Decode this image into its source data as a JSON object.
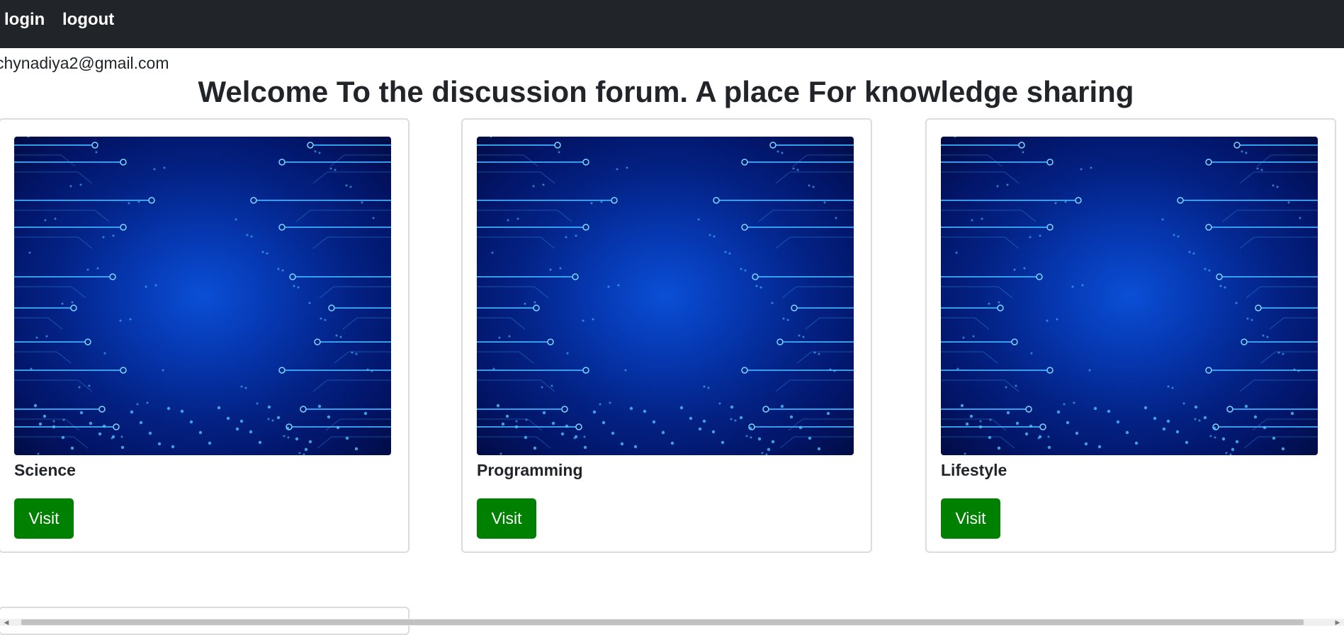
{
  "navbar": {
    "login_label": "login",
    "logout_label": "logout"
  },
  "user": {
    "email": "chynadiya2@gmail.com"
  },
  "page": {
    "title": "Welcome To the discussion forum. A place For knowledge sharing"
  },
  "categories": [
    {
      "title": "Science",
      "button_label": "Visit"
    },
    {
      "title": "Programming",
      "button_label": "Visit"
    },
    {
      "title": "Lifestyle",
      "button_label": "Visit"
    }
  ],
  "colors": {
    "navbar_bg": "#212529",
    "button_bg": "#008000",
    "card_border": "#dcdcdc",
    "image_primary": "#0637b0"
  },
  "icons": {
    "scroll_left": "scroll-left-arrow-icon",
    "scroll_right": "scroll-right-arrow-icon"
  }
}
